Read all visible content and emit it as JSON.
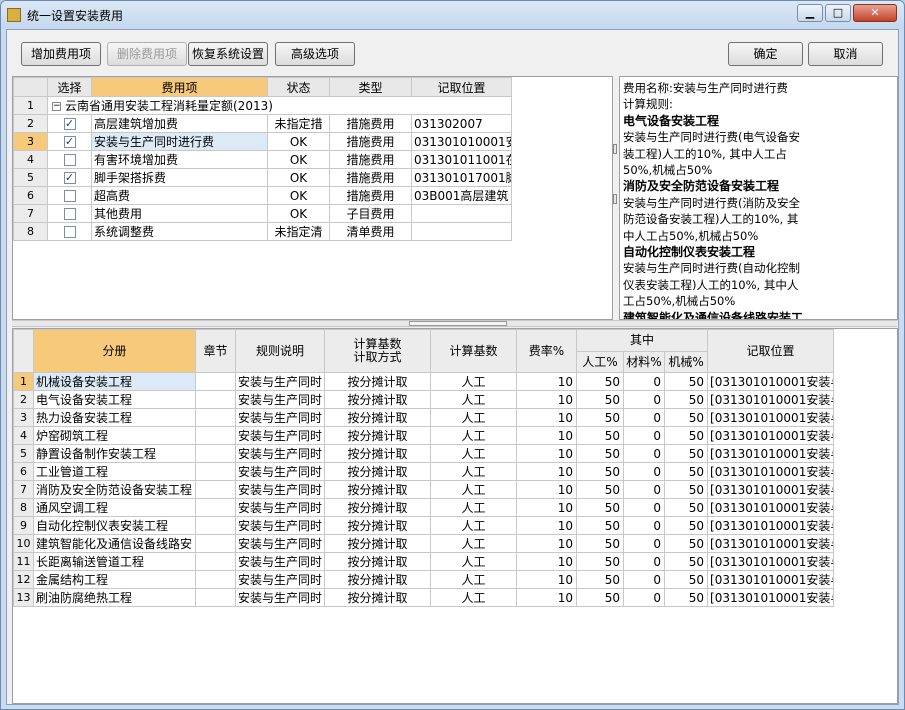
{
  "window": {
    "title": "统一设置安装费用",
    "min_symbol": "▁",
    "max_symbol": "□",
    "close_symbol": "✕"
  },
  "toolbar": {
    "add_label": "增加费用项",
    "delete_label": "删除费用项",
    "restore_label": "恢复系统设置",
    "advanced_label": "高级选项",
    "ok_label": "确定",
    "cancel_label": "取消"
  },
  "top_table": {
    "headers": [
      "选择",
      "费用项",
      "状态",
      "类型",
      "记取位置"
    ],
    "group": {
      "num": "1",
      "label": "云南省通用安装工程消耗量定额(2013)"
    },
    "rows": [
      {
        "num": "2",
        "checked": true,
        "name": "高层建筑增加费",
        "status": "未指定措",
        "type": "措施费用",
        "position": "031302007"
      },
      {
        "num": "3",
        "checked": true,
        "name": "安装与生产同时进行费",
        "status": "OK",
        "type": "措施费用",
        "position": "031301010001安"
      },
      {
        "num": "4",
        "checked": false,
        "name": "有害环境增加费",
        "status": "OK",
        "type": "措施费用",
        "position": "031301011001在"
      },
      {
        "num": "5",
        "checked": true,
        "name": "脚手架搭拆费",
        "status": "OK",
        "type": "措施费用",
        "position": "031301017001脚"
      },
      {
        "num": "6",
        "checked": false,
        "name": "超高费",
        "status": "OK",
        "type": "措施费用",
        "position": "03B001高层建筑"
      },
      {
        "num": "7",
        "checked": false,
        "name": "其他费用",
        "status": "OK",
        "type": "子目费用",
        "position": ""
      },
      {
        "num": "8",
        "checked": false,
        "name": "系统调整费",
        "status": "未指定清",
        "type": "清单费用",
        "position": ""
      }
    ]
  },
  "info": {
    "name_line": "费用名称:安装与生产同时进行费",
    "rule_label": "计算规则:",
    "sections": [
      {
        "heading": "电气设备安装工程",
        "lines": [
          "安装与生产同时进行费(电气设备安",
          "装工程)人工的10%, 其中人工占",
          "50%,机械占50%"
        ]
      },
      {
        "heading": "消防及安全防范设备安装工程",
        "lines": [
          "安装与生产同时进行费(消防及安全",
          "防范设备安装工程)人工的10%, 其",
          "中人工占50%,机械占50%"
        ]
      },
      {
        "heading": "自动化控制仪表安装工程",
        "lines": [
          "安装与生产同时进行费(自动化控制",
          "仪表安装工程)人工的10%, 其中人",
          "工占50%,机械占50%"
        ]
      },
      {
        "heading": "建筑智能化及通信设备线路安装工",
        "lines": []
      }
    ]
  },
  "bottom_table": {
    "headers": {
      "fence": "分册",
      "chapter": "章节",
      "rule": "规则说明",
      "method": "计算基数\n计取方式",
      "base": "计算基数",
      "rate": "费率%",
      "group": "其中",
      "labor": "人工%",
      "material": "材料%",
      "machine": "机械%",
      "position": "记取位置"
    },
    "rows": [
      {
        "num": "1",
        "fence": "机械设备安装工程",
        "chapter": "",
        "rule": "安装与生产同时",
        "method": "按分摊计取",
        "base": "人工",
        "rate": "10",
        "labor": "50",
        "material": "0",
        "machine": "50",
        "position": "[031301010001安装与"
      },
      {
        "num": "2",
        "fence": "电气设备安装工程",
        "chapter": "",
        "rule": "安装与生产同时",
        "method": "按分摊计取",
        "base": "人工",
        "rate": "10",
        "labor": "50",
        "material": "0",
        "machine": "50",
        "position": "[031301010001安装与"
      },
      {
        "num": "3",
        "fence": "热力设备安装工程",
        "chapter": "",
        "rule": "安装与生产同时",
        "method": "按分摊计取",
        "base": "人工",
        "rate": "10",
        "labor": "50",
        "material": "0",
        "machine": "50",
        "position": "[031301010001安装与"
      },
      {
        "num": "4",
        "fence": "炉窑砌筑工程",
        "chapter": "",
        "rule": "安装与生产同时",
        "method": "按分摊计取",
        "base": "人工",
        "rate": "10",
        "labor": "50",
        "material": "0",
        "machine": "50",
        "position": "[031301010001安装与"
      },
      {
        "num": "5",
        "fence": "静置设备制作安装工程",
        "chapter": "",
        "rule": "安装与生产同时",
        "method": "按分摊计取",
        "base": "人工",
        "rate": "10",
        "labor": "50",
        "material": "0",
        "machine": "50",
        "position": "[031301010001安装与"
      },
      {
        "num": "6",
        "fence": "工业管道工程",
        "chapter": "",
        "rule": "安装与生产同时",
        "method": "按分摊计取",
        "base": "人工",
        "rate": "10",
        "labor": "50",
        "material": "0",
        "machine": "50",
        "position": "[031301010001安装与"
      },
      {
        "num": "7",
        "fence": "消防及安全防范设备安装工程",
        "chapter": "",
        "rule": "安装与生产同时",
        "method": "按分摊计取",
        "base": "人工",
        "rate": "10",
        "labor": "50",
        "material": "0",
        "machine": "50",
        "position": "[031301010001安装与"
      },
      {
        "num": "8",
        "fence": "通风空调工程",
        "chapter": "",
        "rule": "安装与生产同时",
        "method": "按分摊计取",
        "base": "人工",
        "rate": "10",
        "labor": "50",
        "material": "0",
        "machine": "50",
        "position": "[031301010001安装与"
      },
      {
        "num": "9",
        "fence": "自动化控制仪表安装工程",
        "chapter": "",
        "rule": "安装与生产同时",
        "method": "按分摊计取",
        "base": "人工",
        "rate": "10",
        "labor": "50",
        "material": "0",
        "machine": "50",
        "position": "[031301010001安装与"
      },
      {
        "num": "10",
        "fence": "建筑智能化及通信设备线路安",
        "chapter": "",
        "rule": "安装与生产同时",
        "method": "按分摊计取",
        "base": "人工",
        "rate": "10",
        "labor": "50",
        "material": "0",
        "machine": "50",
        "position": "[031301010001安装与"
      },
      {
        "num": "11",
        "fence": "长距离输送管道工程",
        "chapter": "",
        "rule": "安装与生产同时",
        "method": "按分摊计取",
        "base": "人工",
        "rate": "10",
        "labor": "50",
        "material": "0",
        "machine": "50",
        "position": "[031301010001安装与"
      },
      {
        "num": "12",
        "fence": "金属结构工程",
        "chapter": "",
        "rule": "安装与生产同时",
        "method": "按分摊计取",
        "base": "人工",
        "rate": "10",
        "labor": "50",
        "material": "0",
        "machine": "50",
        "position": "[031301010001安装与"
      },
      {
        "num": "13",
        "fence": "刷油防腐绝热工程",
        "chapter": "",
        "rule": "安装与生产同时",
        "method": "按分摊计取",
        "base": "人工",
        "rate": "10",
        "labor": "50",
        "material": "0",
        "machine": "50",
        "position": "[031301010001安装与"
      }
    ]
  },
  "colors": {
    "selected_header": "#f7c97a",
    "row_highlight": "#dceaf8",
    "window_frame": "#c9dcf0"
  },
  "icons": {
    "app": "app-icon",
    "checkbox": "checkbox-icon",
    "tree": "tree-collapse-icon"
  }
}
